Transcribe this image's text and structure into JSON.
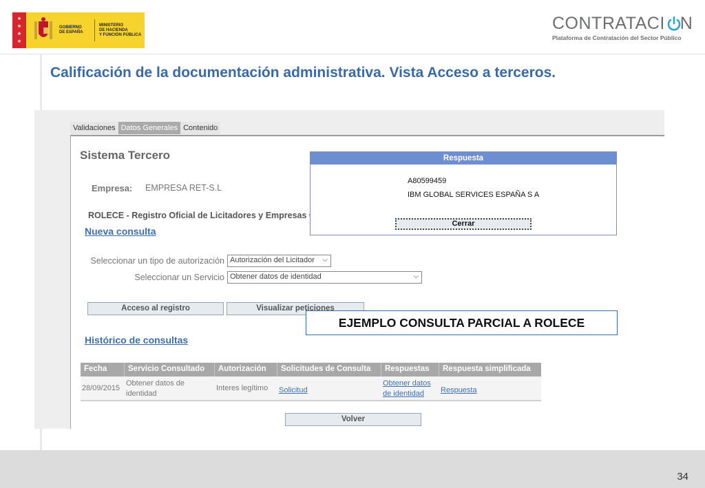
{
  "gov_logo": {
    "line1": "GOBIERNO",
    "line2": "DE ESPAÑA",
    "ministry1": "MINISTERIO",
    "ministry2": "DE HACIENDA",
    "ministry3": "Y FUNCIÓN PÚBLICA"
  },
  "brand_logo": {
    "word": "CONTRATACI",
    "word_end": "N",
    "subtitle": "Plataforma de Contratación del Sector Público"
  },
  "slide": {
    "title": "Calificación de la documentación administrativa. Vista Acceso a terceros.",
    "page_number": "34",
    "callout": "EJEMPLO CONSULTA PARCIAL A ROLECE"
  },
  "tabs": [
    {
      "label": "Validaciones",
      "active": false
    },
    {
      "label": "Datos Generales",
      "active": true
    },
    {
      "label": "Contenido",
      "active": false
    }
  ],
  "panel": {
    "title": "Sistema Tercero",
    "empresa_label": "Empresa:",
    "empresa_value": "EMPRESA RET-S.L",
    "rolece_label": "ROLECE - Registro Oficial de Licitadores y Empresas Cla",
    "new_query_link": "Nueva consulta",
    "auth_type_label": "Seleccionar un tipo de autorización",
    "auth_type_value": "Autorización del Licitador",
    "service_label": "Seleccionar un Servicio",
    "service_value": "Obtener datos de identidad",
    "access_button": "Acceso al registro",
    "view_requests_button": "Visualizar peticiones",
    "history_link": "Histórico de consultas",
    "back_button": "Volver"
  },
  "history_table": {
    "headers": [
      "Fecha",
      "Servicio Consultado",
      "Autorización",
      "Solicitudes de Consulta",
      "Respuestas",
      "Respuesta simplificada"
    ],
    "rows": [
      {
        "fecha": "28/09/2015",
        "servicio_1": "Obtener datos de",
        "servicio_2": "identidad",
        "autorizacion": "Interes legítimo",
        "solicitud": "Solicitud",
        "respuestas_1": "Obtener datos",
        "respuestas_2": "de identidad",
        "respuesta_simplificada": "Respuesta"
      }
    ]
  },
  "popup": {
    "title": "Respuesta",
    "line1": "A80599459",
    "line2": "IBM GLOBAL SERVICES ESPAÑA S A",
    "close_button": "Cerrar"
  },
  "colors": {
    "title_blue": "#3a69a8",
    "link_blue": "#3d6fb0",
    "popup_header": "#6d8fd1",
    "table_header": "#a8a8a8",
    "footer_gray": "#dcdcdc",
    "gov_yellow": "#f6d32d",
    "gov_red": "#d6252d",
    "brand_power_blue": "#2aa3dc"
  }
}
